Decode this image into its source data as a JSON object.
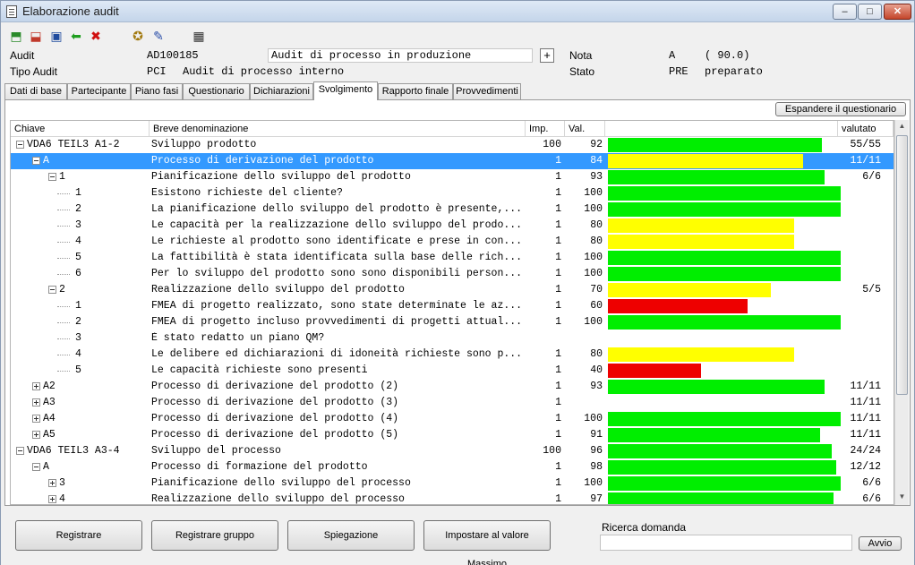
{
  "window": {
    "title": "Elaborazione audit",
    "minimize": "–",
    "maximize": "□",
    "close": "✕"
  },
  "toolbar": {
    "icons": [
      {
        "name": "new-record-icon",
        "glyph": "⬒",
        "color": "#2a8a2a"
      },
      {
        "name": "delete-record-icon",
        "glyph": "⬓",
        "color": "#c0392b"
      },
      {
        "name": "save-icon",
        "glyph": "▣",
        "color": "#1f4b9e"
      },
      {
        "name": "back-arrow-icon",
        "glyph": "⬅",
        "color": "#1e9e1e"
      },
      {
        "name": "cancel-icon",
        "glyph": "✖",
        "color": "#d01010"
      },
      {
        "name": "tools-icon",
        "glyph": "✪",
        "color": "#a27a10"
      },
      {
        "name": "edit-document-icon",
        "glyph": "✎",
        "color": "#2a4ea8"
      },
      {
        "name": "calculator-icon",
        "glyph": "▦",
        "color": "#333333"
      }
    ]
  },
  "header": {
    "audit_label": "Audit",
    "audit_code": "AD100185",
    "audit_title": "Audit di processo in produzione",
    "plus_button": "+",
    "nota_label": "Nota",
    "nota_grade": "A",
    "nota_value": "( 90.0)",
    "tipo_label": "Tipo Audit",
    "tipo_code": "PCI",
    "tipo_desc": "Audit di processo interno",
    "stato_label": "Stato",
    "stato_code": "PRE",
    "stato_desc": "preparato"
  },
  "tabs": [
    "Dati di base",
    "Partecipante",
    "Piano fasi",
    "Questionario",
    "Dichiarazioni",
    "Svolgimento",
    "Rapporto finale",
    "Provvedimenti"
  ],
  "active_tab": "Svolgimento",
  "expand_button": "Espandere il questionario",
  "columns": {
    "key": "Chiave",
    "name": "Breve denominazione",
    "imp": "Imp.",
    "val": "Val.",
    "bar": "",
    "rated": "valutato"
  },
  "colors": {
    "green": "#00ee00",
    "yellow": "#ffff00",
    "red": "#ee0000",
    "selection": "#3399ff"
  },
  "rows": [
    {
      "level": 0,
      "toggle": "minus",
      "key": "VDA6 TEIL3 A1-2",
      "name": "Sviluppo prodotto",
      "imp": "100",
      "val": "92",
      "bar_pct": 92,
      "bar_color": "green",
      "rated": "55/55"
    },
    {
      "level": 1,
      "toggle": "minus",
      "key": "A",
      "name": "Processo di derivazione del prodotto",
      "imp": "1",
      "val": "84",
      "bar_pct": 84,
      "bar_color": "yellow",
      "rated": "11/11",
      "selected": true
    },
    {
      "level": 2,
      "toggle": "minus",
      "key": "1",
      "name": "Pianificazione dello sviluppo del prodotto",
      "imp": "1",
      "val": "93",
      "bar_pct": 93,
      "bar_color": "green",
      "rated": "6/6"
    },
    {
      "level": 3,
      "toggle": "none",
      "key": "1",
      "name": "Esistono richieste del cliente?",
      "imp": "1",
      "val": "100",
      "bar_pct": 100,
      "bar_color": "green",
      "rated": ""
    },
    {
      "level": 3,
      "toggle": "none",
      "key": "2",
      "name": "La pianificazione dello sviluppo del prodotto è presente,...",
      "imp": "1",
      "val": "100",
      "bar_pct": 100,
      "bar_color": "green",
      "rated": ""
    },
    {
      "level": 3,
      "toggle": "none",
      "key": "3",
      "name": "Le capacità per la realizzazione dello sviluppo del prodo...",
      "imp": "1",
      "val": "80",
      "bar_pct": 80,
      "bar_color": "yellow",
      "rated": ""
    },
    {
      "level": 3,
      "toggle": "none",
      "key": "4",
      "name": "Le richieste al prodotto sono identificate e prese in con...",
      "imp": "1",
      "val": "80",
      "bar_pct": 80,
      "bar_color": "yellow",
      "rated": ""
    },
    {
      "level": 3,
      "toggle": "none",
      "key": "5",
      "name": "La fattibilità è stata identificata sulla base delle rich...",
      "imp": "1",
      "val": "100",
      "bar_pct": 100,
      "bar_color": "green",
      "rated": ""
    },
    {
      "level": 3,
      "toggle": "none",
      "key": "6",
      "name": "Per lo sviluppo del prodotto sono sono disponibili person...",
      "imp": "1",
      "val": "100",
      "bar_pct": 100,
      "bar_color": "green",
      "rated": ""
    },
    {
      "level": 2,
      "toggle": "minus",
      "key": "2",
      "name": "Realizzazione dello sviluppo del prodotto",
      "imp": "1",
      "val": "70",
      "bar_pct": 70,
      "bar_color": "yellow",
      "rated": "5/5"
    },
    {
      "level": 3,
      "toggle": "none",
      "key": "1",
      "name": "FMEA di progetto realizzato, sono state determinate le az...",
      "imp": "1",
      "val": "60",
      "bar_pct": 60,
      "bar_color": "red",
      "rated": ""
    },
    {
      "level": 3,
      "toggle": "none",
      "key": "2",
      "name": "FMEA di progetto incluso provvedimenti di progetti attual...",
      "imp": "1",
      "val": "100",
      "bar_pct": 100,
      "bar_color": "green",
      "rated": ""
    },
    {
      "level": 3,
      "toggle": "none",
      "key": "3",
      "name": "È stato redatto un piano QM?",
      "imp": "",
      "val": "",
      "bar_pct": 0,
      "bar_color": "green",
      "rated": ""
    },
    {
      "level": 3,
      "toggle": "none",
      "key": "4",
      "name": "Le delibere ed dichiarazioni di idoneità richieste sono p...",
      "imp": "1",
      "val": "80",
      "bar_pct": 80,
      "bar_color": "yellow",
      "rated": ""
    },
    {
      "level": 3,
      "toggle": "none",
      "key": "5",
      "name": "Le capacità richieste sono presenti",
      "imp": "1",
      "val": "40",
      "bar_pct": 40,
      "bar_color": "red",
      "rated": ""
    },
    {
      "level": 1,
      "toggle": "plus",
      "key": "A2",
      "name": "Processo di derivazione del prodotto (2)",
      "imp": "1",
      "val": "93",
      "bar_pct": 93,
      "bar_color": "green",
      "rated": "11/11"
    },
    {
      "level": 1,
      "toggle": "plus",
      "key": "A3",
      "name": "Processo di derivazione del prodotto (3)",
      "imp": "1",
      "val": "",
      "bar_pct": 0,
      "bar_color": "green",
      "rated": "11/11"
    },
    {
      "level": 1,
      "toggle": "plus",
      "key": "A4",
      "name": "Processo di derivazione del prodotto (4)",
      "imp": "1",
      "val": "100",
      "bar_pct": 100,
      "bar_color": "green",
      "rated": "11/11"
    },
    {
      "level": 1,
      "toggle": "plus",
      "key": "A5",
      "name": "Processo di derivazione del prodotto (5)",
      "imp": "1",
      "val": "91",
      "bar_pct": 91,
      "bar_color": "green",
      "rated": "11/11"
    },
    {
      "level": 0,
      "toggle": "minus",
      "key": "VDA6 TEIL3 A3-4",
      "name": "Sviluppo del processo",
      "imp": "100",
      "val": "96",
      "bar_pct": 96,
      "bar_color": "green",
      "rated": "24/24"
    },
    {
      "level": 1,
      "toggle": "minus",
      "key": "A",
      "name": "Processo di formazione del prodotto",
      "imp": "1",
      "val": "98",
      "bar_pct": 98,
      "bar_color": "green",
      "rated": "12/12"
    },
    {
      "level": 2,
      "toggle": "plus",
      "key": "3",
      "name": "Pianificazione dello sviluppo del processo",
      "imp": "1",
      "val": "100",
      "bar_pct": 100,
      "bar_color": "green",
      "rated": "6/6"
    },
    {
      "level": 2,
      "toggle": "plus",
      "key": "4",
      "name": "Realizzazione dello sviluppo del processo",
      "imp": "1",
      "val": "97",
      "bar_pct": 97,
      "bar_color": "green",
      "rated": "6/6"
    }
  ],
  "footer": {
    "btn_register": "Registrare",
    "btn_register_group": "Registrare gruppo",
    "btn_explain": "Spiegazione",
    "btn_set_max": "Impostare al valore Massimo",
    "search_label": "Ricerca domanda",
    "search_value": "",
    "search_button": "Avvio"
  }
}
